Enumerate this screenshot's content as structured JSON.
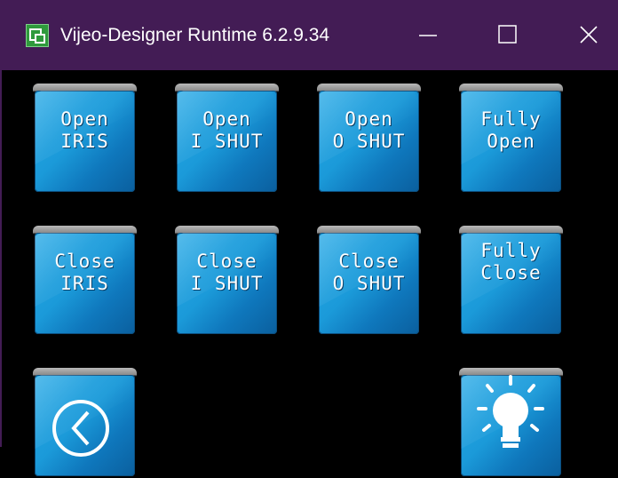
{
  "window": {
    "title": "Vijeo-Designer Runtime 6.2.9.34",
    "controls": [
      "minimize-icon",
      "maximize-icon",
      "close-icon"
    ]
  },
  "colors": {
    "titlebar": "#431c55",
    "background": "#000000",
    "button_face": "#1b9ad9",
    "button_text": "#ffffff"
  },
  "buttons": [
    {
      "line1": "Open",
      "line2": "IRIS"
    },
    {
      "line1": "Open",
      "line2": "I SHUT"
    },
    {
      "line1": "Open",
      "line2": "O SHUT"
    },
    {
      "line1": "Fully",
      "line2": "Open"
    },
    {
      "line1": "Close",
      "line2": "IRIS"
    },
    {
      "line1": "Close",
      "line2": "I SHUT"
    },
    {
      "line1": "Close",
      "line2": "O SHUT"
    },
    {
      "line1": "Fully",
      "line2": "Close"
    }
  ],
  "icon_buttons": [
    {
      "icon": "back-arrow-icon"
    },
    {
      "icon": "light-bulb-icon"
    }
  ]
}
